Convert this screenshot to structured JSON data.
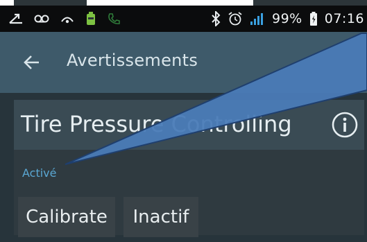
{
  "status_bar": {
    "left_icons": [
      "missed-call-icon",
      "voicemail-icon",
      "cast-icon",
      "battery-app-icon",
      "phone-icon"
    ],
    "right_icons": [
      "bluetooth-icon",
      "alarm-icon",
      "signal-icon",
      "battery-icon"
    ],
    "battery_percent": "99%",
    "time": "07:16"
  },
  "app_bar": {
    "back_icon": "arrow-left-icon",
    "title": "Avertissements"
  },
  "card": {
    "title": "Tire Pressure Controlling",
    "info_icon": "info-icon",
    "status": "Activé"
  },
  "buttons": {
    "calibrate_label": "Calibrate",
    "inactive_label": "Inactif"
  },
  "colors": {
    "status_bar_bg": "#0b0c0d",
    "app_bar_bg": "#3e5a6a",
    "card_header_bg": "#3a4b54",
    "status_text": "#5aa7d3",
    "button_bg": "#394247",
    "callout_fill": "#4a7bb7"
  }
}
